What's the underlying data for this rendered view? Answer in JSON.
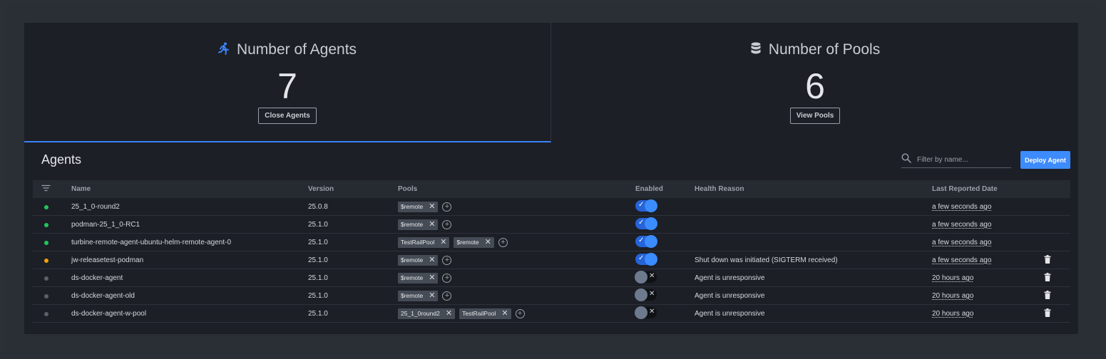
{
  "stats": {
    "agents": {
      "title": "Number of Agents",
      "value": "7",
      "button": "Close Agents",
      "icon": "running-person-icon",
      "icon_color": "#3b82f6"
    },
    "pools": {
      "title": "Number of Pools",
      "value": "6",
      "button": "View Pools",
      "icon": "database-icon",
      "icon_color": "#c9ccd2"
    }
  },
  "agents_section": {
    "title": "Agents",
    "search_placeholder": "Filter by name...",
    "deploy_label": "Deploy Agent"
  },
  "table": {
    "columns": {
      "name": "Name",
      "version": "Version",
      "pools": "Pools",
      "enabled": "Enabled",
      "health": "Health Reason",
      "date": "Last Reported Date"
    },
    "rows": [
      {
        "status": "green",
        "name": "25_1_0-round2",
        "version": "25.0.8",
        "pools": [
          "$remote"
        ],
        "enabled": true,
        "health": "",
        "date": "a few seconds ago",
        "deletable": false
      },
      {
        "status": "green",
        "name": "podman-25_1_0-RC1",
        "version": "25.1.0",
        "pools": [
          "$remote"
        ],
        "enabled": true,
        "health": "",
        "date": "a few seconds ago",
        "deletable": false
      },
      {
        "status": "green",
        "name": "turbine-remote-agent-ubuntu-helm-remote-agent-0",
        "version": "25.1.0",
        "pools": [
          "TestRailPool",
          "$remote"
        ],
        "enabled": true,
        "health": "",
        "date": "a few seconds ago",
        "deletable": false
      },
      {
        "status": "orange",
        "name": "jw-releasetest-podman",
        "version": "25.1.0",
        "pools": [
          "$remote"
        ],
        "enabled": true,
        "health": "Shut down was initiated (SIGTERM received)",
        "date": "a few seconds ago",
        "deletable": true
      },
      {
        "status": "gray",
        "name": "ds-docker-agent",
        "version": "25.1.0",
        "pools": [
          "$remote"
        ],
        "enabled": false,
        "health": "Agent is unresponsive",
        "date": "20 hours ago",
        "deletable": true
      },
      {
        "status": "gray",
        "name": "ds-docker-agent-old",
        "version": "25.1.0",
        "pools": [
          "$remote"
        ],
        "enabled": false,
        "health": "Agent is unresponsive",
        "date": "20 hours ago",
        "deletable": true
      },
      {
        "status": "gray",
        "name": "ds-docker-agent-w-pool",
        "version": "25.1.0",
        "pools": [
          "25_1_0round2",
          "TestRailPool"
        ],
        "enabled": false,
        "health": "Agent is unresponsive",
        "date": "20 hours ago",
        "deletable": true
      }
    ]
  },
  "colors": {
    "green": "#22c55e",
    "orange": "#f59e0b",
    "gray": "#5b6069",
    "accent": "#3d8bfd"
  }
}
